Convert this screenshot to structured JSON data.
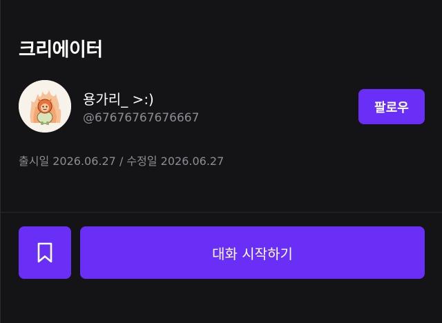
{
  "section": {
    "title": "크리에이터"
  },
  "creator": {
    "name": "용가리_ >:)",
    "handle": "@67676767676667",
    "avatar_icon": "dragon-character-avatar",
    "follow_label": "팔로우"
  },
  "meta": {
    "release_info": "출시일 2026.06.27 / 수정일 2026.06.27"
  },
  "actions": {
    "bookmark_icon": "bookmark-icon",
    "start_chat_label": "대화 시작하기"
  },
  "colors": {
    "background": "#141316",
    "accent": "#6a2ff7",
    "muted_text": "#8e8d94",
    "divider": "#2a292e"
  }
}
